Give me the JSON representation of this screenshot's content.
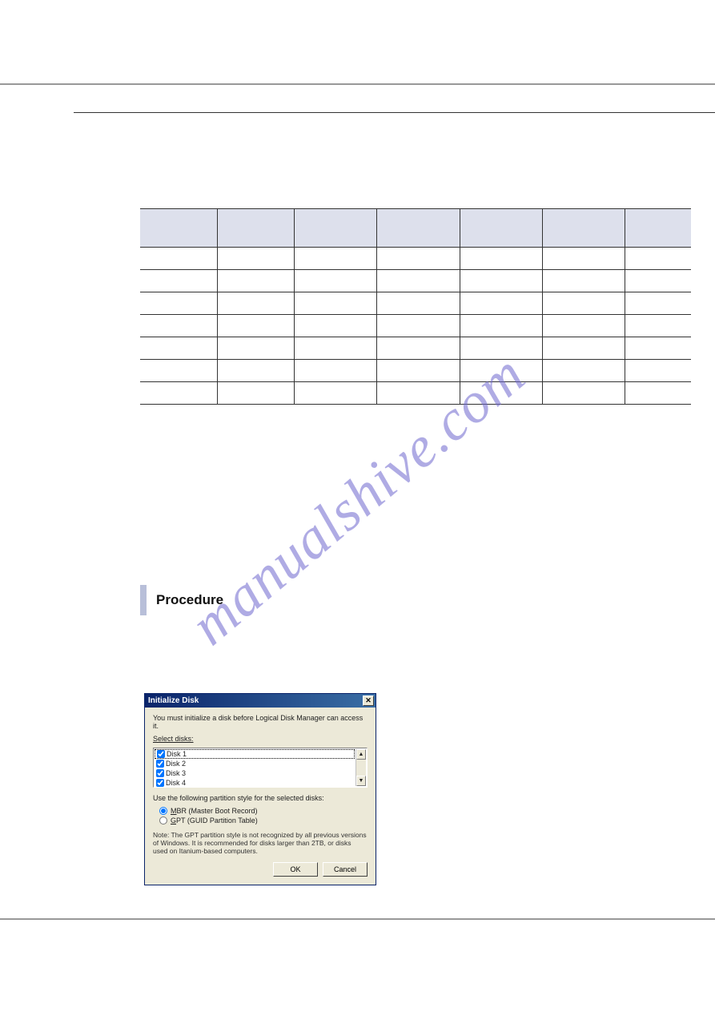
{
  "watermark": "manualshive.com",
  "procedure": {
    "label": "Procedure"
  },
  "dialog": {
    "title": "Initialize Disk",
    "intro": "You must initialize a disk before Logical Disk Manager can access it.",
    "select_label": "Select disks:",
    "disks": [
      "Disk 1",
      "Disk 2",
      "Disk 3",
      "Disk 4"
    ],
    "partition_label": "Use the following partition style for the selected disks:",
    "radio_mbr": "MBR (Master Boot Record)",
    "radio_gpt": "GPT (GUID Partition Table)",
    "note": "Note: The GPT partition style is not recognized by all previous versions of Windows. It is recommended for disks larger than 2TB, or disks used on Itanium-based computers.",
    "ok": "OK",
    "cancel": "Cancel"
  }
}
